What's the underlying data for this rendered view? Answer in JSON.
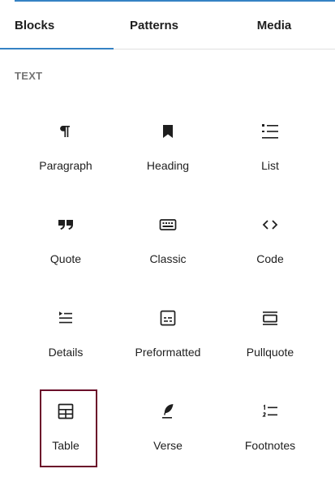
{
  "tabs": [
    {
      "label": "Blocks",
      "active": true
    },
    {
      "label": "Patterns",
      "active": false
    },
    {
      "label": "Media",
      "active": false
    }
  ],
  "section": {
    "title": "TEXT"
  },
  "blocks": [
    {
      "label": "Paragraph",
      "icon": "paragraph-icon"
    },
    {
      "label": "Heading",
      "icon": "heading-icon"
    },
    {
      "label": "List",
      "icon": "list-icon"
    },
    {
      "label": "Quote",
      "icon": "quote-icon"
    },
    {
      "label": "Classic",
      "icon": "classic-icon"
    },
    {
      "label": "Code",
      "icon": "code-icon"
    },
    {
      "label": "Details",
      "icon": "details-icon"
    },
    {
      "label": "Preformatted",
      "icon": "preformatted-icon"
    },
    {
      "label": "Pullquote",
      "icon": "pullquote-icon"
    },
    {
      "label": "Table",
      "icon": "table-icon",
      "selected": true
    },
    {
      "label": "Verse",
      "icon": "verse-icon"
    },
    {
      "label": "Footnotes",
      "icon": "footnotes-icon"
    }
  ],
  "colors": {
    "accent": "#3582c4",
    "selection_border": "#6b0f2a",
    "muted": "#757575",
    "text": "#1e1e1e"
  }
}
